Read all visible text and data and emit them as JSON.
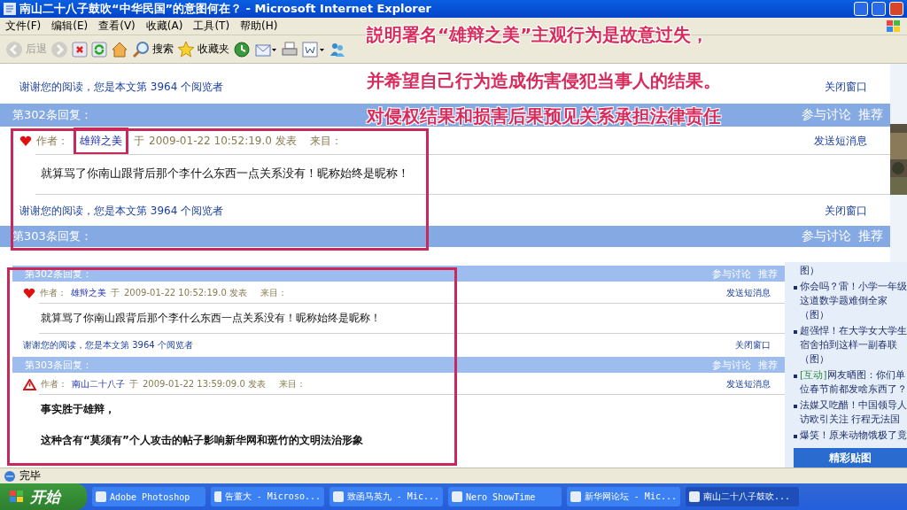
{
  "window": {
    "title": "南山二十八子鼓吹“中华民国”的意图何在？ - Microsoft Internet Explorer"
  },
  "menu": [
    "文件(F)",
    "编辑(E)",
    "查看(V)",
    "收藏(A)",
    "工具(T)",
    "帮助(H)"
  ],
  "toolbar": [
    {
      "kind": "back",
      "label": "后退",
      "disabled": true
    },
    {
      "kind": "forward",
      "disabled": true
    },
    {
      "kind": "stop",
      "disabled": false
    },
    {
      "kind": "refresh",
      "disabled": false
    },
    {
      "kind": "home",
      "disabled": false
    },
    {
      "kind": "search",
      "label": "搜索",
      "disabled": false
    },
    {
      "kind": "favorites",
      "label": "收藏夹",
      "disabled": false
    },
    {
      "kind": "history",
      "disabled": false
    },
    {
      "kind": "mail",
      "disabled": false
    },
    {
      "kind": "print",
      "disabled": false
    },
    {
      "kind": "word",
      "disabled": false
    },
    {
      "kind": "messenger",
      "disabled": false
    }
  ],
  "annotations": [
    "説明署名“雄辩之美”主观行为是故意过失，",
    "并希望自己行为造成伤害侵犯当事人的结果。",
    "对侵权结果和损害后果预见关系承担法律责任"
  ],
  "page": {
    "thanks": "谢谢您的阅读，您是本文第 3964 个阅览者",
    "close": "关闭窗口",
    "reply": {
      "header": "第302条回复：",
      "actions": [
        "参与讨论",
        "推荐"
      ],
      "author_label": "作者：",
      "author": "雄辩之美",
      "at": "于",
      "time": "2009-01-22 10:52:19.0 发表",
      "from": "来目：",
      "message": "发送短消息",
      "body": "就算骂了你南山跟背后那个李什么东西一点关系没有！昵称始终是昵称！",
      "thanks": "谢谢您的阅读，您是本文第 3964 个阅览者",
      "close": "关闭窗口"
    },
    "next_header": {
      "header": "第303条回复：",
      "actions": [
        "参与讨论",
        "推荐"
      ]
    }
  },
  "inset": {
    "replies": [
      {
        "kind": "heart",
        "header": "第302条回复：",
        "actions": [
          "参与讨论",
          "推荐"
        ],
        "author_label": "作者：",
        "author": "雄辩之美",
        "at": "于",
        "time": "2009-01-22 10:52:19.0 发表",
        "from": "来目：",
        "message": "发送短消息",
        "bold": false,
        "body": [
          "就算骂了你南山跟背后那个李什么东西一点关系没有！昵称始终是昵称！"
        ],
        "thanks": "谢谢您的阅读，您是本文第 3964 个阅览者",
        "close": "关闭窗口"
      },
      {
        "kind": "warning",
        "header": "第303条回复：",
        "actions": [
          "参与讨论",
          "推荐"
        ],
        "author_label": "作者：",
        "author": "南山二十八子",
        "at": "于",
        "time": "2009-01-22 13:59:09.0 发表",
        "from": "来目：",
        "message": "发送短消息",
        "bold": true,
        "body": [
          "事实胜于雄辩，",
          "这种含有“莫须有”个人攻击的帖子影响新华网和斑竹的文明法治形象"
        ]
      }
    ],
    "side_list": [
      {
        "lines": [
          "图）"
        ],
        "bullet": false
      },
      {
        "lines": [
          "你会吗？雷！小学一年级",
          "这道数学题难倒全家",
          "（图）"
        ],
        "bullet": true
      },
      {
        "lines": [
          "超强悍！在大学女大学生",
          "宿舍拍到这样一副春联",
          "（图）"
        ],
        "bullet": true
      },
      {
        "tag": "[互动]",
        "lines": [
          "网友晒图：你们单",
          "位春节前都发啥东西了？"
        ],
        "bullet": true
      },
      {
        "lines": [
          "法媒又吃醋！中国领导人",
          "访欧引关注 行程无法国"
        ],
        "bullet": true
      },
      {
        "lines": [
          "爆笑！原来动物饿极了竟"
        ],
        "bullet": true
      }
    ],
    "side_button": "精彩贴图"
  },
  "status": "完毕",
  "taskbar": {
    "start": "开始",
    "items": [
      {
        "label": "Adobe Photoshop",
        "selected": false
      },
      {
        "label": "告董大 - Microso...",
        "selected": false
      },
      {
        "label": "致函马英九 - Mic...",
        "selected": false
      },
      {
        "label": "Nero ShowTime",
        "selected": false
      },
      {
        "label": "新华网论坛 - Mic...",
        "selected": false
      },
      {
        "label": "南山二十八子鼓吹...",
        "selected": true
      }
    ]
  }
}
